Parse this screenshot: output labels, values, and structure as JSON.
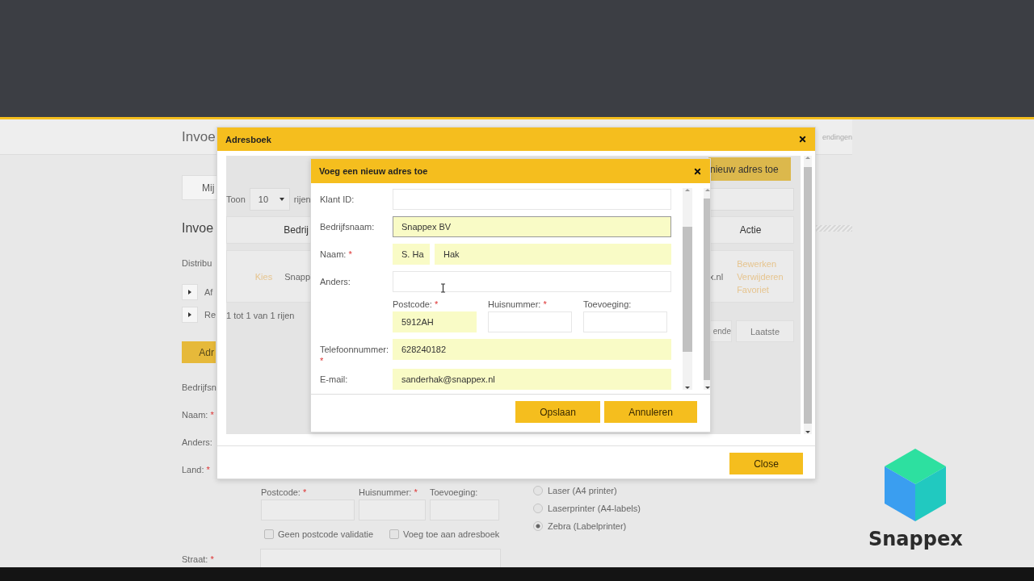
{
  "page": {
    "title": "Invoe",
    "header_text": "endingen",
    "tab_button": "Mij",
    "section_title": "Invoe",
    "distribution_label": "Distribu",
    "expanders": [
      "Af",
      "Re"
    ],
    "address_book_button": "Adr",
    "labels": [
      {
        "text": "Bedrijfsn"
      },
      {
        "text": "Naam:",
        "mark": "*"
      },
      {
        "text": "Anders:"
      },
      {
        "text": "Land:",
        "mark": "*"
      }
    ],
    "address_fields": [
      {
        "label": "Postcode:",
        "mark": "*"
      },
      {
        "label": "Huisnummer:",
        "mark": "*"
      },
      {
        "label": "Toevoeging:"
      }
    ],
    "checkboxes": [
      {
        "label": "Geen postcode validatie",
        "checked": false
      },
      {
        "label": "Voeg toe aan adresboek",
        "checked": false
      }
    ],
    "street_label": {
      "text": "Straat:",
      "mark": "*"
    },
    "printers": [
      {
        "label": "Laser (A4 printer)",
        "selected": false
      },
      {
        "label": "Laserprinter (A4-labels)",
        "selected": false
      },
      {
        "label": "Zebra (Labelprinter)",
        "selected": true
      }
    ]
  },
  "address_book": {
    "title": "Adresboek",
    "add_button": "nieuw adres toe",
    "show_label": "Toon",
    "page_size": "10",
    "rows_label": "rijen",
    "columns": [
      "Bedrij",
      "Actie"
    ],
    "row": {
      "choose": "Kies",
      "company": "Snapp",
      "email": "x.nl",
      "actions": [
        "Bewerken",
        "Verwijderen",
        "Favoriet"
      ]
    },
    "info": "1 tot 1 van 1 rijen",
    "pager": [
      "ende",
      "Laatste"
    ],
    "close_button": "Close"
  },
  "new_address": {
    "title": "Voeg een nieuw adres toe",
    "fields": [
      {
        "kind": "text",
        "label": "Klant ID:",
        "focused": false
      },
      {
        "kind": "text",
        "label": "Bedrijfsnaam:",
        "value": "Snappex BV",
        "focused": true
      },
      {
        "kind": "name",
        "label": "Naam:",
        "mark": "*",
        "parts": [
          "S. Ha",
          "Hak"
        ]
      },
      {
        "kind": "text",
        "label": "Anders:",
        "focused": false,
        "pointer": true
      },
      {
        "kind": "address",
        "parts": [
          {
            "label": "Postcode:",
            "mark": "*",
            "value": "5912AH"
          },
          {
            "label": "Huisnummer:",
            "mark": "*"
          },
          {
            "label": "Toevoeging:"
          }
        ]
      },
      {
        "kind": "text",
        "label": "Telefoonnummer:",
        "mark": "*",
        "value": "628240182",
        "focused": false
      },
      {
        "kind": "text",
        "label": "E-mail:",
        "value": "sanderhak@snappex.nl",
        "focused": false
      }
    ],
    "buttons": [
      "Opslaan",
      "Annuleren"
    ]
  },
  "logo": {
    "name": "Snappex"
  }
}
